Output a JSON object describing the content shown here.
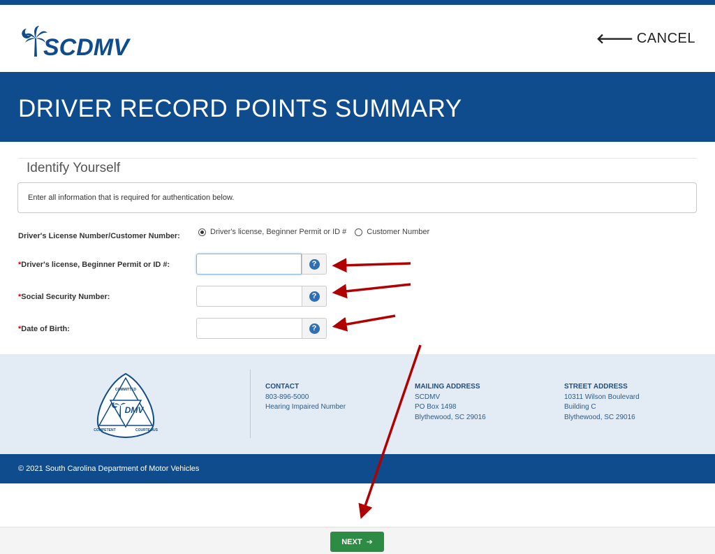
{
  "header": {
    "logo_text": "SCDMV",
    "cancel_label": "CANCEL"
  },
  "banner": {
    "title": "DRIVER RECORD POINTS SUMMARY"
  },
  "form": {
    "section_title": "Identify Yourself",
    "instructions": "Enter all information that is required for authentication below.",
    "id_type_label": "Driver's License Number/Customer Number:",
    "id_type_options": [
      {
        "label": "Driver's license, Beginner Permit or ID #",
        "selected": true
      },
      {
        "label": "Customer Number",
        "selected": false
      }
    ],
    "required_marker": "*",
    "fields": [
      {
        "label": "Driver's license, Beginner Permit or ID #:",
        "value": "",
        "placeholder": ""
      },
      {
        "label": "Social Security Number:",
        "value": "",
        "placeholder": ""
      },
      {
        "label": "Date of Birth:",
        "value": "",
        "placeholder": ""
      }
    ],
    "help_glyph": "?"
  },
  "footer": {
    "logo_words": [
      "COMMITTED",
      "DMV",
      "COMPETENT",
      "COURTEOUS"
    ],
    "contact": {
      "heading": "CONTACT",
      "lines": [
        "803-896-5000",
        "Hearing Impaired Number"
      ]
    },
    "mailing": {
      "heading": "MAILING ADDRESS",
      "lines": [
        "SCDMV",
        "PO Box 1498",
        "Blythewood, SC 29016"
      ]
    },
    "street": {
      "heading": "STREET ADDRESS",
      "lines": [
        "10311 Wilson Boulevard",
        "Building C",
        "Blythewood, SC 29016"
      ]
    },
    "copyright": "© 2021 South Carolina Department of Motor Vehicles"
  },
  "actions": {
    "next_label": "NEXT"
  },
  "colors": {
    "brand_blue": "#0f4c8d",
    "next_green": "#2e8b44",
    "annotation_red": "#b00000"
  }
}
